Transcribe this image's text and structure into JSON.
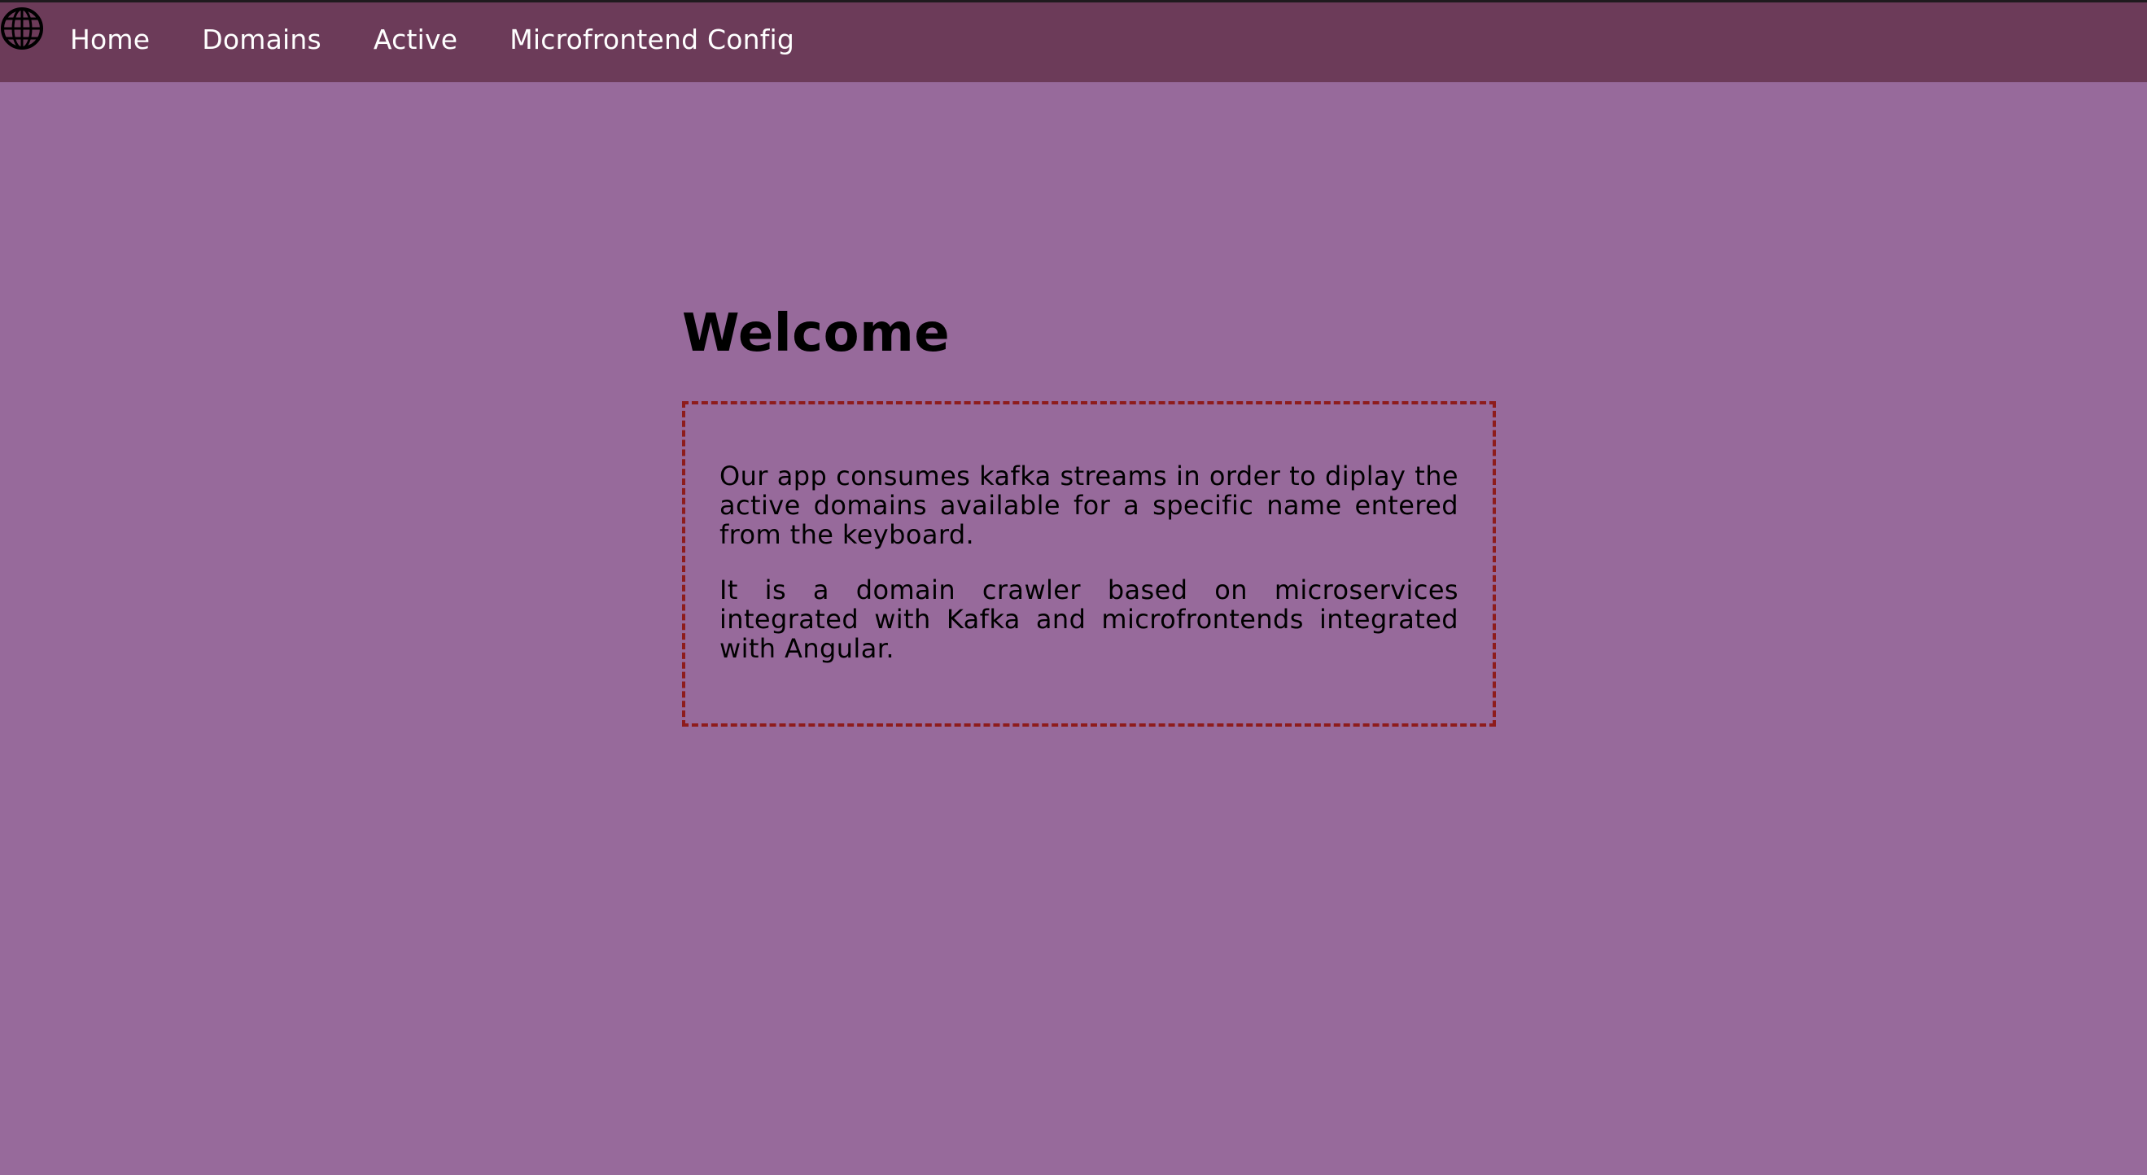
{
  "nav": {
    "logo_icon": "globe-icon",
    "items": [
      {
        "label": "Home"
      },
      {
        "label": "Domains"
      },
      {
        "label": "Active"
      },
      {
        "label": "Microfrontend Config"
      }
    ]
  },
  "main": {
    "title": "Welcome",
    "paragraphs": [
      "Our app consumes kafka streams in order to diplay the active domains available for a specific name entered from the keyboard.",
      "It is a domain crawler based on microservices integrated with Kafka and microfrontends integrated with Angular."
    ]
  },
  "colors": {
    "page_background": "#976a9b",
    "navbar_background": "#6c3b59",
    "card_border": "#8e1c1c",
    "nav_text": "#ffffff",
    "body_text": "#000000"
  }
}
